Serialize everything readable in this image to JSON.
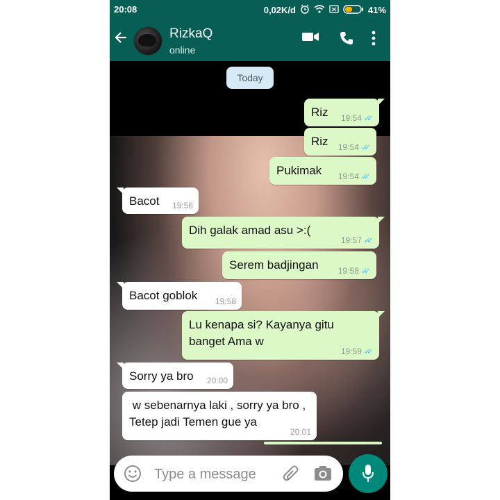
{
  "status_bar": {
    "time": "20:08",
    "network_speed": "0,02K/d",
    "battery": "41%"
  },
  "header": {
    "contact_name": "RizkaQ",
    "contact_status": "online"
  },
  "chat": {
    "date_chip": "Today",
    "messages": [
      {
        "dir": "out",
        "text": "Riz",
        "time": "19:54"
      },
      {
        "dir": "out",
        "text": "Riz",
        "time": "19:54"
      },
      {
        "dir": "out",
        "text": "Pukimak",
        "time": "19:54"
      },
      {
        "dir": "in",
        "text": "Bacot",
        "time": "19:56"
      },
      {
        "dir": "out",
        "text": "Dih galak amad asu >:(",
        "time": "19:57"
      },
      {
        "dir": "out",
        "text": "Serem badjingan",
        "time": "19:58"
      },
      {
        "dir": "in",
        "text": "Bacot goblok",
        "time": "19:58"
      },
      {
        "dir": "out",
        "text": "Lu kenapa si? Kayanya gitu banget Ama w",
        "time": "19:59"
      },
      {
        "dir": "in",
        "text": "Sorry ya bro",
        "time": "20:00"
      },
      {
        "dir": "in",
        "text": " w sebenarnya laki , sorry ya bro , Tetep jadi Temen gue ya",
        "time": "20:01"
      }
    ]
  },
  "input": {
    "placeholder": "Type a message"
  },
  "colors": {
    "header": "#075e54",
    "outgoing_bubble": "#dcf8c6",
    "incoming_bubble": "#ffffff",
    "read_tick": "#4fc3f7",
    "mic_button": "#00897b"
  },
  "icons": [
    "back-arrow-icon",
    "video-call-icon",
    "voice-call-icon",
    "more-options-icon",
    "emoji-icon",
    "attach-icon",
    "camera-icon",
    "mic-icon",
    "wifi-icon",
    "alarm-icon",
    "battery-icon"
  ]
}
